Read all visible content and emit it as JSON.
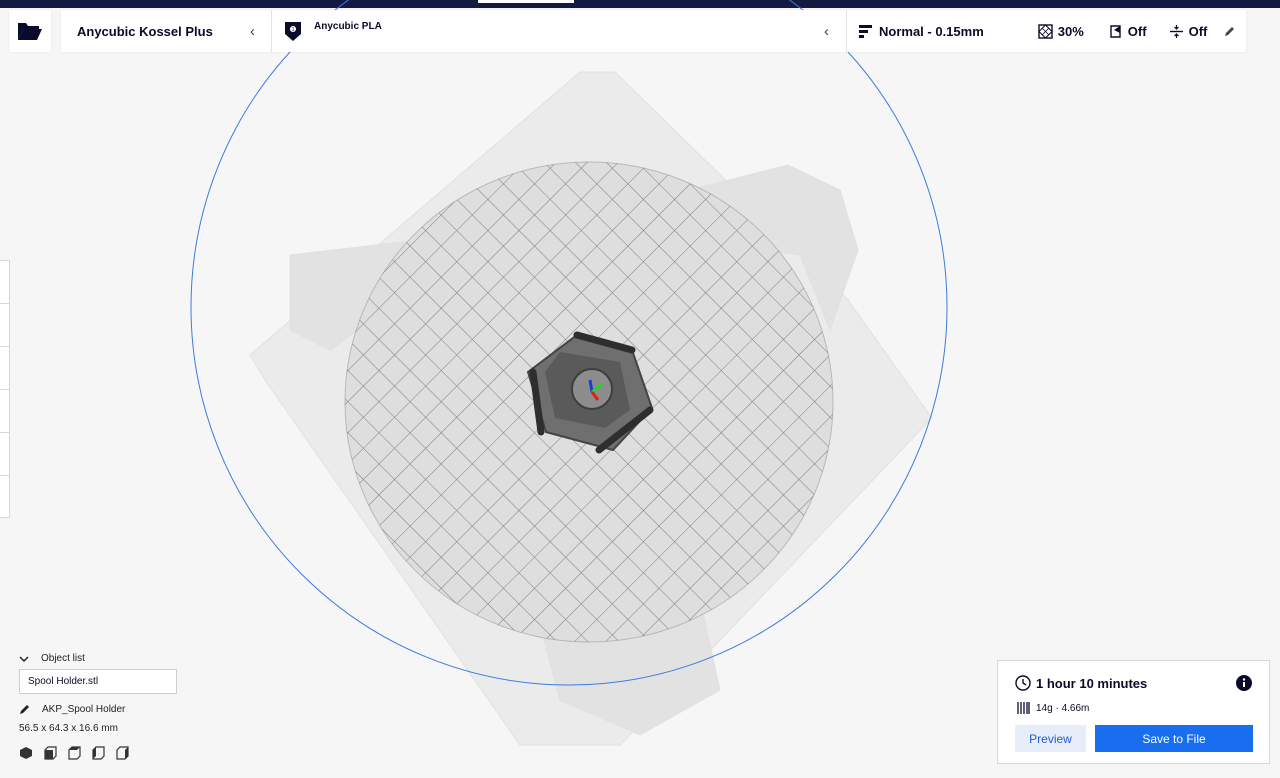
{
  "header": {
    "printer": "Anycubic Kossel Plus",
    "material": "Anycubic PLA",
    "profile": "Normal - 0.15mm",
    "infill": "30%",
    "support": "Off",
    "adhesion": "Off"
  },
  "icons": {
    "open": "folder-open-icon",
    "extruder": "extruder-icon",
    "profile": "profile-bars-icon",
    "infill": "infill-icon",
    "support": "support-icon",
    "adhesion": "adhesion-icon",
    "edit": "pencil-icon"
  },
  "object_list": {
    "title": "Object list",
    "selected_file": "Spool Holder.stl",
    "object_name": "AKP_Spool Holder",
    "dimensions": "56.5 x 64.3 x 16.6 mm"
  },
  "print_info": {
    "time": "1 hour 10 minutes",
    "material_usage": "14g · 4.66m",
    "preview_label": "Preview",
    "save_label": "Save to File"
  },
  "colors": {
    "accent": "#196ef0",
    "topbar": "#14193f",
    "bed": "#dedede",
    "model": "#4a4a4a"
  }
}
